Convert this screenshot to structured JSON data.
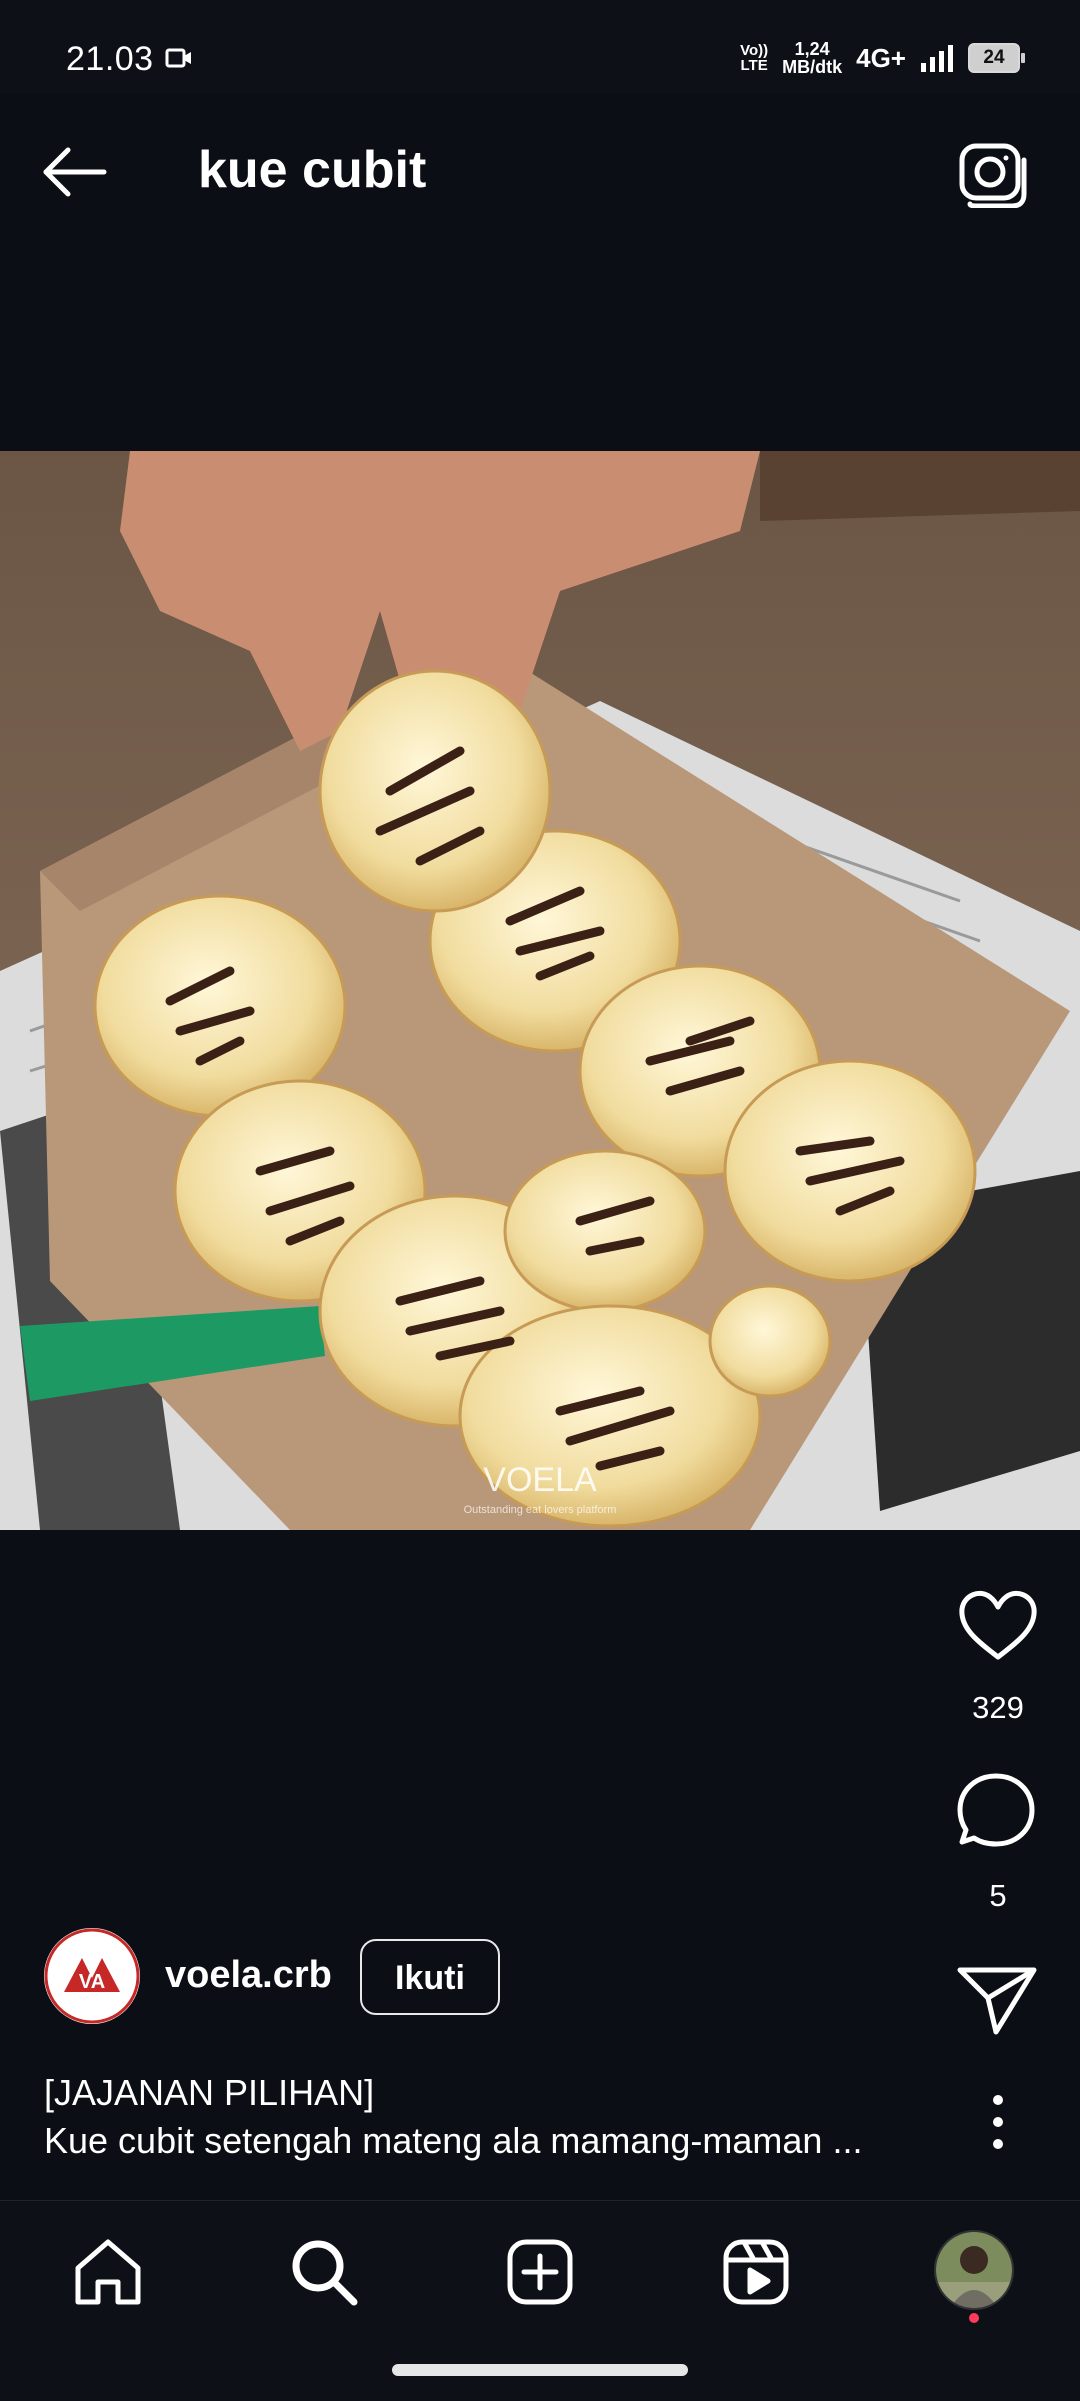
{
  "status_bar": {
    "time": "21.03",
    "volte_top": "Vo))",
    "volte_bottom": "LTE",
    "speed_value": "1,24",
    "speed_unit": "MB/dtk",
    "network": "4G+",
    "battery": "24"
  },
  "header": {
    "title": "kue cubit",
    "back_icon": "arrow-left-icon",
    "camera_icon": "camera-icon"
  },
  "post": {
    "image_watermark": "VOELA",
    "image_watermark_sub": "Outstanding eat lovers platform",
    "likes": "329",
    "comments": "5",
    "author": {
      "username": "voela.crb",
      "avatar_text": "VA"
    },
    "follow_label": "Ikuti",
    "caption_line1": "[JAJANAN PILIHAN]",
    "caption_line2": "Kue cubit setengah mateng ala mamang-maman ..."
  },
  "bottom_nav": {
    "items": [
      "home-icon",
      "search-icon",
      "create-icon",
      "reels-icon",
      "profile-avatar"
    ]
  },
  "colors": {
    "background": "#0b0e14",
    "accent_dot": "#ff3b5c",
    "avatar_brand": "#c62828"
  }
}
